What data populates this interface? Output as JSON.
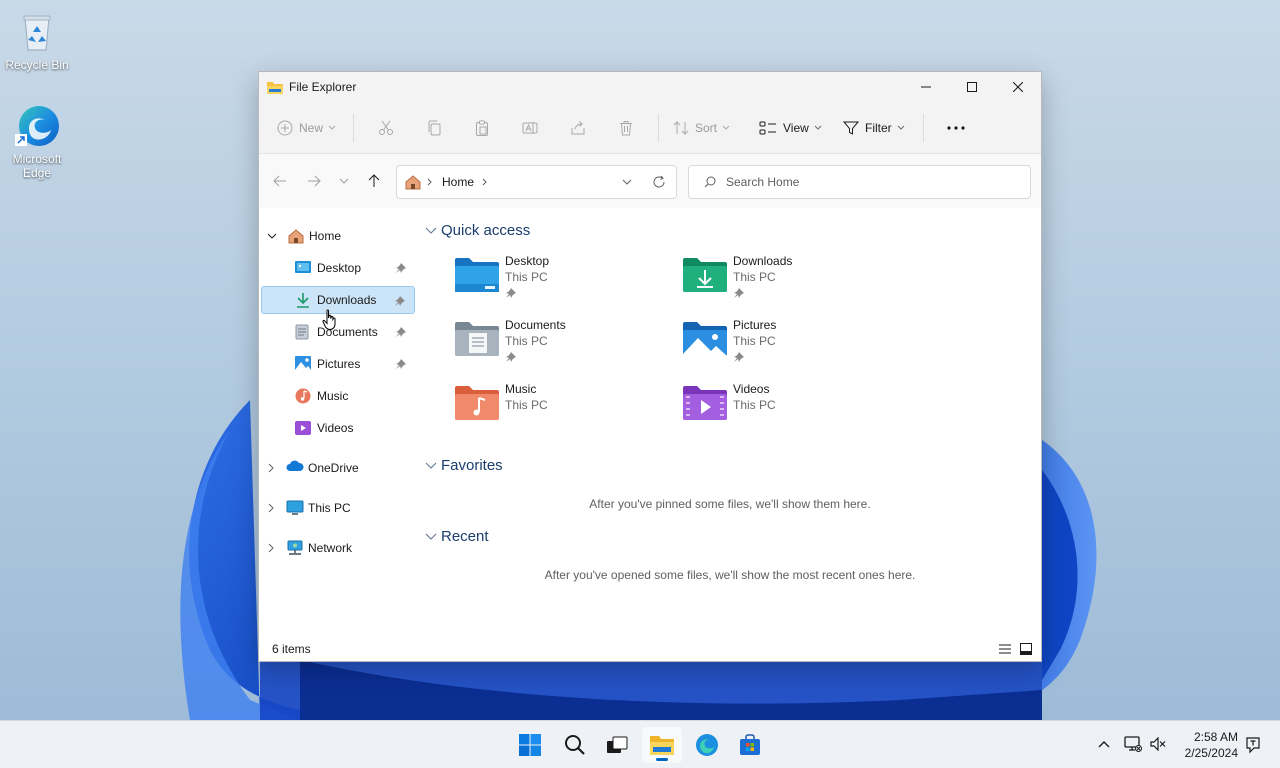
{
  "desktop": {
    "icons": [
      {
        "label": "Recycle Bin",
        "icon": "recycle-bin-icon"
      },
      {
        "label": "Microsoft Edge",
        "icon": "edge-icon"
      }
    ]
  },
  "window": {
    "title": "File Explorer",
    "toolbar": {
      "new_label": "New",
      "sort_label": "Sort",
      "view_label": "View",
      "filter_label": "Filter"
    },
    "address": {
      "crumb": "Home"
    },
    "search": {
      "placeholder": "Search Home"
    },
    "sidebar": {
      "home": "Home",
      "pinned": [
        {
          "label": "Desktop"
        },
        {
          "label": "Downloads"
        },
        {
          "label": "Documents"
        },
        {
          "label": "Pictures"
        }
      ],
      "unpinned": [
        {
          "label": "Music"
        },
        {
          "label": "Videos"
        }
      ],
      "roots": [
        {
          "label": "OneDrive"
        },
        {
          "label": "This PC"
        },
        {
          "label": "Network"
        }
      ]
    },
    "quick_access": {
      "title": "Quick access",
      "items": [
        {
          "name": "Desktop",
          "location": "This PC"
        },
        {
          "name": "Downloads",
          "location": "This PC"
        },
        {
          "name": "Documents",
          "location": "This PC"
        },
        {
          "name": "Pictures",
          "location": "This PC"
        },
        {
          "name": "Music",
          "location": "This PC"
        },
        {
          "name": "Videos",
          "location": "This PC"
        }
      ]
    },
    "favorites": {
      "title": "Favorites",
      "empty": "After you've pinned some files, we'll show them here."
    },
    "recent": {
      "title": "Recent",
      "empty": "After you've opened some files, we'll show the most recent ones here."
    },
    "status": "6 items"
  },
  "taskbar": {
    "time": "2:58 AM",
    "date": "2/25/2024"
  },
  "colors": {
    "accent": "#0067c0",
    "selection": "#cce4f7",
    "section_header": "#1a3e6e"
  }
}
